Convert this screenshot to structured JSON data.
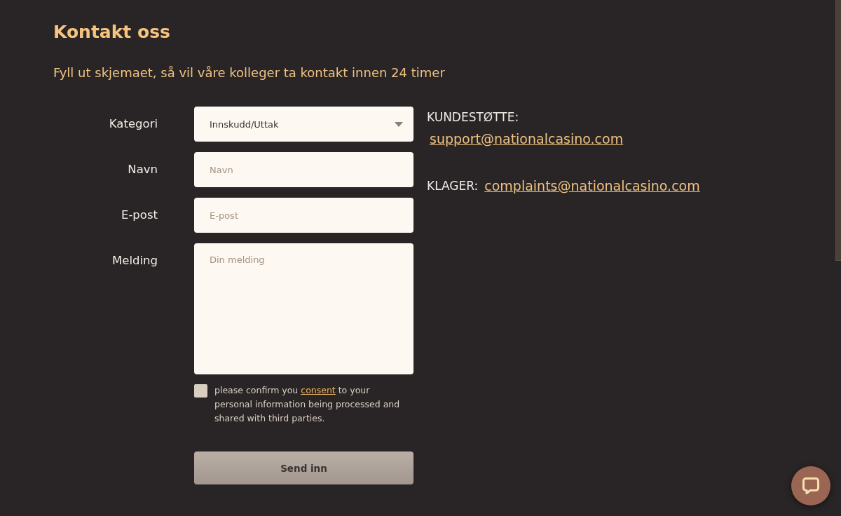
{
  "page": {
    "title": "Kontakt oss",
    "subtitle": "Fyll ut skjemaet, så vil våre kolleger ta kontakt innen 24 timer"
  },
  "form": {
    "fields": [
      {
        "kind": "select",
        "label": "Kategori",
        "value": "Innskudd/Uttak"
      },
      {
        "kind": "text",
        "label": "Navn",
        "placeholder": "Navn"
      },
      {
        "kind": "text",
        "label": "E-post",
        "placeholder": "E-post"
      },
      {
        "kind": "textarea",
        "label": "Melding",
        "placeholder": "Din melding"
      }
    ],
    "consent": {
      "checked": false,
      "text_before": "please confirm you",
      "link": "consent",
      "text_after": "to your personal information being processed and shared with third parties."
    },
    "submit": "Send inn"
  },
  "contacts": [
    {
      "kind": "stacked",
      "label": "KUNDESTØTTE:",
      "email": "support@nationalcasino.com"
    },
    {
      "kind": "inline",
      "label": "KLAGER:",
      "email": "complaints@nationalcasino.com"
    }
  ]
}
